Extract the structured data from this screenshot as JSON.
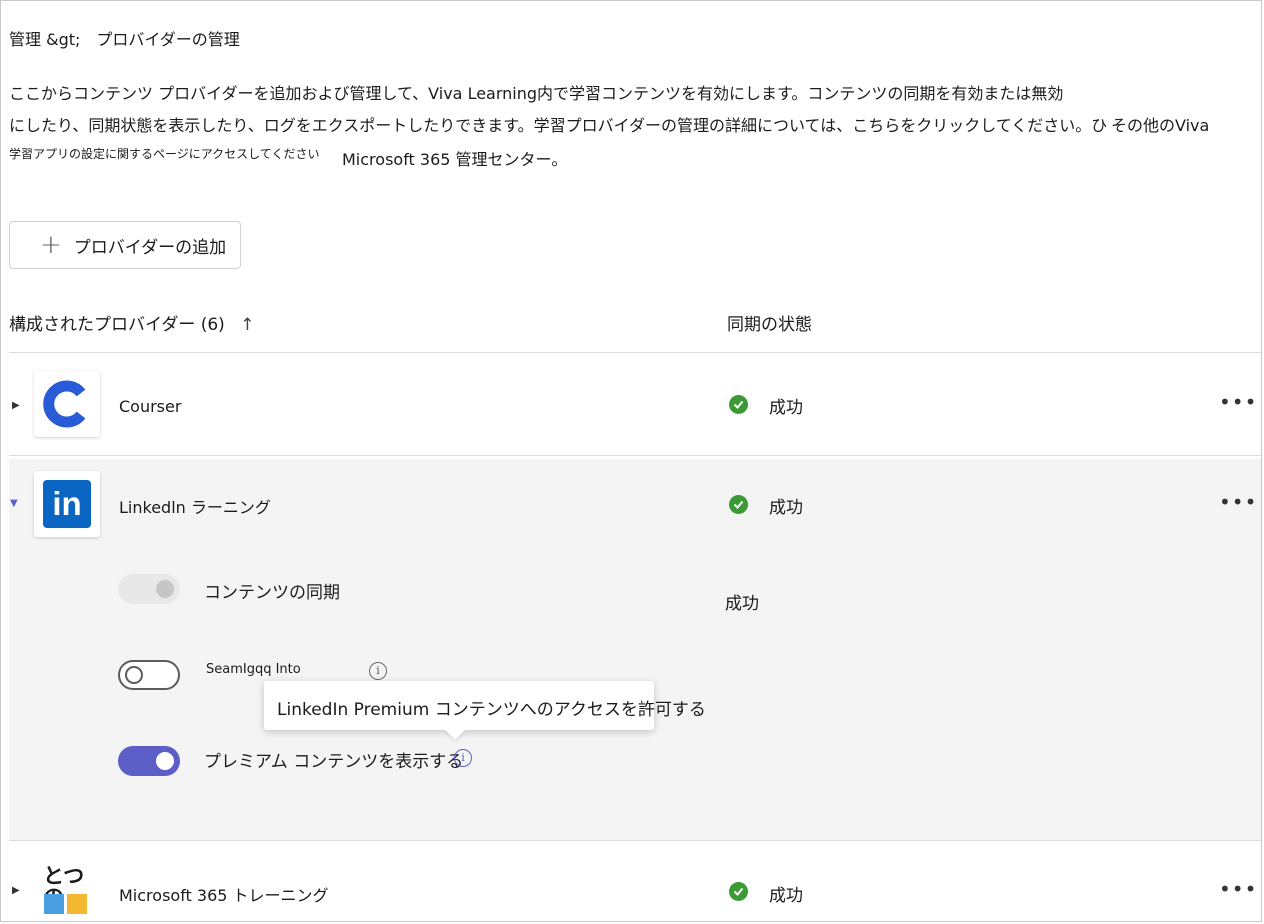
{
  "breadcrumb": "管理 &gt;　プロバイダーの管理",
  "description": {
    "line1": "ここからコンテンツ プロバイダーを追加および管理して、Viva Learning内で学習コンテンツを有効にします。コンテンツの同期を有効または無効",
    "line2": "にしたり、同期状態を表示したり、ログをエクスポートしたりできます。学習プロバイダーの管理の詳細については、こちらをクリックしてください。ひ",
    "line2_tail": "その他のViva",
    "line3_small": "学習アプリの設定に関するページにアクセスしてください",
    "line3_rest": "Microsoft 365 管理センター。"
  },
  "add_button": {
    "icon": "plus-icon",
    "label": "プロバイダーの追加"
  },
  "table": {
    "providers_header": "構成されたプロバイダー (6)",
    "sort_icon": "arrow-up-icon",
    "status_header": "同期の状態"
  },
  "providers": [
    {
      "name": "Courser",
      "logo": "coursera-logo",
      "status": "成功",
      "expanded": false
    },
    {
      "name": "Linkedln ラーニング",
      "logo": "linkedin-logo",
      "status": "成功",
      "expanded": true
    },
    {
      "name": "Microsoft 365 トレーニング",
      "logo": "microsoft-365-logo",
      "logo_text": "とつの",
      "status": "成功",
      "expanded": false
    }
  ],
  "details": {
    "content_sync_label": "コンテンツの同期",
    "content_sync_status": "成功",
    "seamless_label": "SeamIgqq Into",
    "premium_label": "プレミアム コンテンツを表示する",
    "tooltip": "LinkedIn Premium コンテンツへのアクセスを許可する"
  },
  "colors": {
    "accent": "#5b5fc7",
    "success": "#3c9a35",
    "coursera": "#2a5bd7",
    "linkedin": "#0a66c2"
  }
}
